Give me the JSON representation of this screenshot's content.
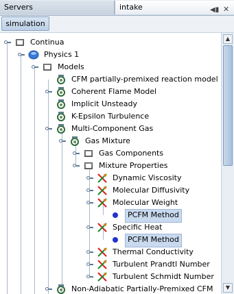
{
  "tabs": {
    "servers": "Servers",
    "intake": "intake"
  },
  "toolbar": {
    "simulation": "simulation"
  },
  "tree": [
    {
      "label": "Continua",
      "icon": "folder-icon"
    },
    {
      "label": "Physics 1",
      "icon": "physics-continuum-icon"
    },
    {
      "label": "Models",
      "icon": "folder-icon"
    },
    {
      "label": "CFM partially-premixed reaction model",
      "icon": "model-icon"
    },
    {
      "label": "Coherent Flame Model",
      "icon": "model-icon"
    },
    {
      "label": "Implicit Unsteady",
      "icon": "model-icon"
    },
    {
      "label": "K-Epsilon Turbulence",
      "icon": "model-icon"
    },
    {
      "label": "Multi-Component Gas",
      "icon": "model-icon"
    },
    {
      "label": "Gas Mixture",
      "icon": "gas-mixture-icon"
    },
    {
      "label": "Gas Components",
      "icon": "folder-icon"
    },
    {
      "label": "Mixture Properties",
      "icon": "folder-icon"
    },
    {
      "label": "Dynamic Viscosity",
      "icon": "property-icon"
    },
    {
      "label": "Molecular Diffusivity",
      "icon": "property-icon"
    },
    {
      "label": "Molecular Weight",
      "icon": "property-icon"
    },
    {
      "label": "PCFM Method",
      "icon": "method-icon"
    },
    {
      "label": "Specific Heat",
      "icon": "property-icon"
    },
    {
      "label": "PCFM Method",
      "icon": "method-icon"
    },
    {
      "label": "Thermal Conductivity",
      "icon": "property-icon"
    },
    {
      "label": "Turbulent Prandtl Number",
      "icon": "property-icon"
    },
    {
      "label": "Turbulent Schmidt Number",
      "icon": "property-icon"
    },
    {
      "label": "Non-Adiabatic Partially-Premixed CFM",
      "icon": "model-icon"
    }
  ]
}
